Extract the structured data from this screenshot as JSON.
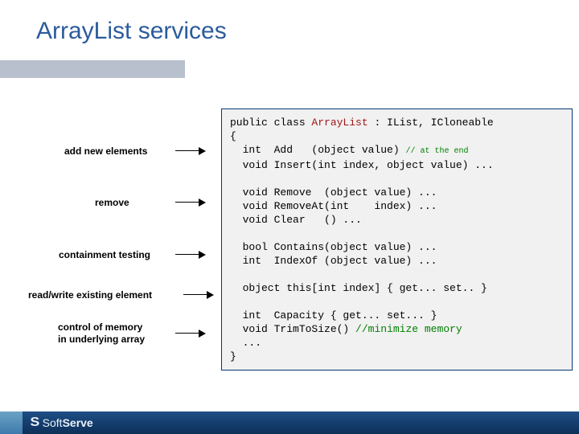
{
  "title": "ArrayList services",
  "labels": {
    "add": "add new elements",
    "remove": "remove",
    "contain": "containment testing",
    "rw": "read/write existing element",
    "mem1": "control of memory",
    "mem2": "in underlying array"
  },
  "code": {
    "l1a": "public class ",
    "l1b": "ArrayList",
    "l1c": " : IList, ICloneable",
    "l2": "{",
    "l3a": "  int  Add   (object value) ",
    "l3b": "// at the end",
    "l4": "  void Insert(int index, object value) ...",
    "l5": "",
    "l6": "  void Remove  (object value) ...",
    "l7": "  void RemoveAt(int    index) ...",
    "l8": "  void Clear   () ...",
    "l9": "",
    "l10": "  bool Contains(object value) ...",
    "l11": "  int  IndexOf (object value) ...",
    "l12": "",
    "l13": "  object this[int index] { get... set.. }",
    "l14": "",
    "l15": "  int  Capacity { get... set... }",
    "l16a": "  void TrimToSize() ",
    "l16b": "//minimize memory",
    "l17": "  ...",
    "l18": "}"
  },
  "footer": {
    "soft": "Soft",
    "serve": "Serve"
  }
}
